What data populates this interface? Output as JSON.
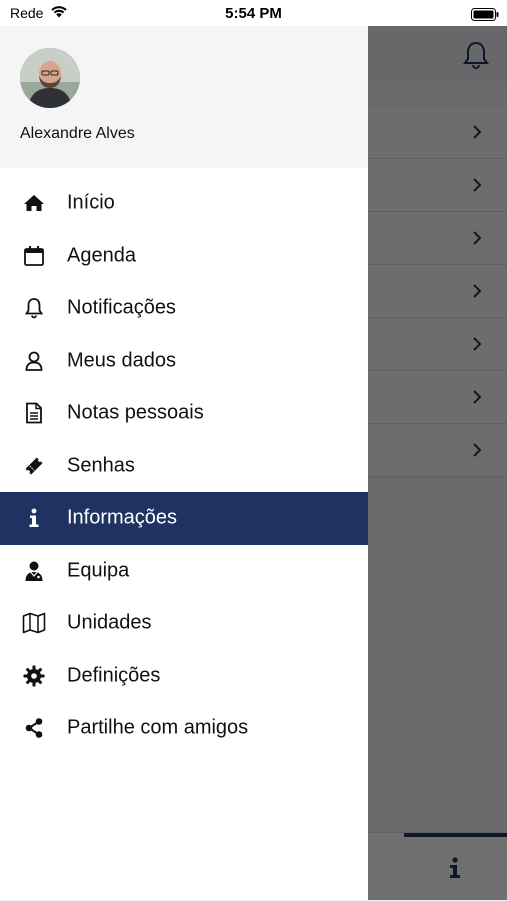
{
  "status_bar": {
    "carrier": "Rede",
    "time": "5:54 PM"
  },
  "user": {
    "name": "Alexandre Alves"
  },
  "menu": {
    "items": [
      {
        "label": "Início",
        "icon": "home-icon"
      },
      {
        "label": "Agenda",
        "icon": "calendar-icon"
      },
      {
        "label": "Notificações",
        "icon": "bell-icon"
      },
      {
        "label": "Meus dados",
        "icon": "user-icon"
      },
      {
        "label": "Notas pessoais",
        "icon": "document-icon"
      },
      {
        "label": "Senhas",
        "icon": "ticket-icon"
      },
      {
        "label": "Informações",
        "icon": "info-icon",
        "active": true
      },
      {
        "label": "Equipa",
        "icon": "team-icon"
      },
      {
        "label": "Unidades",
        "icon": "map-icon"
      },
      {
        "label": "Definições",
        "icon": "gear-icon"
      },
      {
        "label": "Partilhe com amigos",
        "icon": "share-icon"
      }
    ]
  },
  "colors": {
    "accent": "#1f3363",
    "drawer_header_bg": "#f5f5f5"
  }
}
